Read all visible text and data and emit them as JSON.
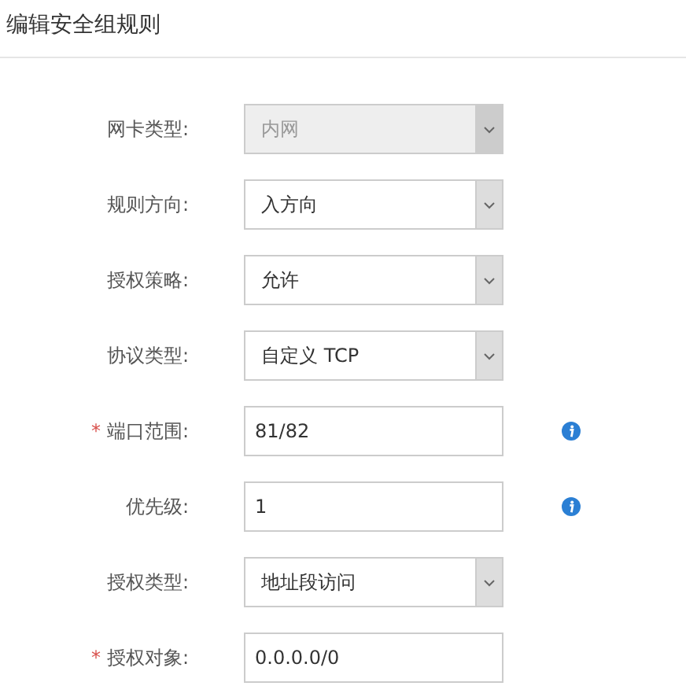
{
  "title": "编辑安全组规则",
  "fields": [
    {
      "label": "网卡类型:",
      "kind": "select",
      "value": "内网",
      "disabled": true,
      "info": false
    },
    {
      "label": "规则方向:",
      "kind": "select",
      "value": "入方向",
      "disabled": false,
      "info": false
    },
    {
      "label": "授权策略:",
      "kind": "select",
      "value": "允许",
      "disabled": false,
      "info": false
    },
    {
      "label": "协议类型:",
      "kind": "select",
      "value": "自定义 TCP",
      "disabled": false,
      "info": false
    },
    {
      "required_mark": "*",
      "label": "端口范围:",
      "kind": "input",
      "value": "81/82",
      "disabled": false,
      "info": true
    },
    {
      "label": "优先级:",
      "kind": "input",
      "value": "1",
      "disabled": false,
      "info": true
    },
    {
      "label": "授权类型:",
      "kind": "select",
      "value": "地址段访问",
      "disabled": false,
      "info": false
    },
    {
      "required_mark": "*",
      "label": "授权对象:",
      "kind": "input",
      "value": "0.0.0.0/0",
      "disabled": false,
      "info": false
    }
  ]
}
